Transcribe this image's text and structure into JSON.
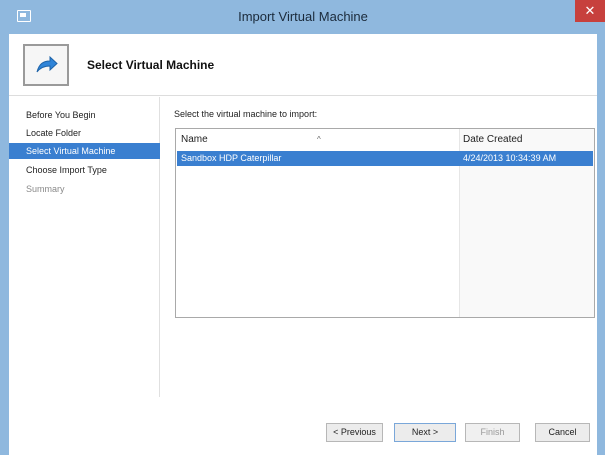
{
  "window": {
    "title": "Import Virtual Machine",
    "close_glyph": "✕"
  },
  "header": {
    "title": "Select Virtual Machine",
    "icon": "arrow-forward-icon"
  },
  "nav": {
    "items": [
      {
        "label": "Before You Begin",
        "state": "normal"
      },
      {
        "label": "Locate Folder",
        "state": "normal"
      },
      {
        "label": "Select Virtual Machine",
        "state": "active"
      },
      {
        "label": "Choose Import Type",
        "state": "normal"
      },
      {
        "label": "Summary",
        "state": "disabled"
      }
    ]
  },
  "main": {
    "instruction": "Select the virtual machine to import:",
    "table": {
      "columns": [
        "Name",
        "Date Created"
      ],
      "sort_glyph": "^",
      "rows": [
        {
          "name": "Sandbox HDP Caterpillar",
          "date_created": "4/24/2013 10:34:39 AM",
          "selected": true
        }
      ]
    }
  },
  "buttons": {
    "previous": "< Previous",
    "next": "Next >",
    "finish": "Finish",
    "cancel": "Cancel"
  },
  "colors": {
    "titlebar": "#8fb8de",
    "selection": "#3a7fd0",
    "close": "#c7403d"
  }
}
